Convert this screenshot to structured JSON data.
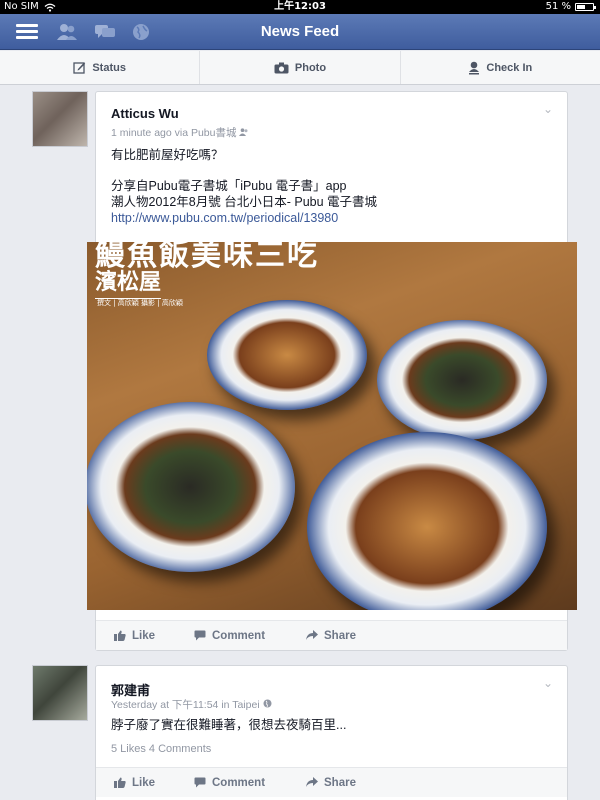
{
  "status_bar": {
    "carrier": "No SIM",
    "time": "上午12:03",
    "battery": "51 %",
    "battery_level": 0.51
  },
  "navbar": {
    "title": "News Feed",
    "icons": [
      "menu-icon",
      "friends-icon",
      "messages-icon",
      "globe-icon"
    ]
  },
  "composer": {
    "status": "Status",
    "photo": "Photo",
    "check_in": "Check In"
  },
  "posts": [
    {
      "author": "Atticus Wu",
      "meta": "1 minute ago via Pubu書城",
      "text_line1": "有比肥前屋好吃嗎？",
      "text_line2": "分享自Pubu電子書城「iPubu 電子書」app",
      "text_line3": "潮人物2012年8月號 台北小日本- Pubu 電子書城",
      "link": "http://www.pubu.com.tw/periodical/13980",
      "photo_headline": "鰻魚飯美味三吃",
      "photo_subhead": "濱松屋",
      "photo_credit": "撰文 | 高欣穎   攝影 | 高欣穎",
      "actions": {
        "like": "Like",
        "comment": "Comment",
        "share": "Share"
      }
    },
    {
      "author": "郭建甫",
      "meta": "Yesterday at 下午11:54 in Taipei",
      "text_line1": "脖子廢了實在很難睡著，很想去夜騎百里...",
      "stats": "5 Likes   4 Comments",
      "actions": {
        "like": "Like",
        "comment": "Comment",
        "share": "Share"
      }
    }
  ]
}
